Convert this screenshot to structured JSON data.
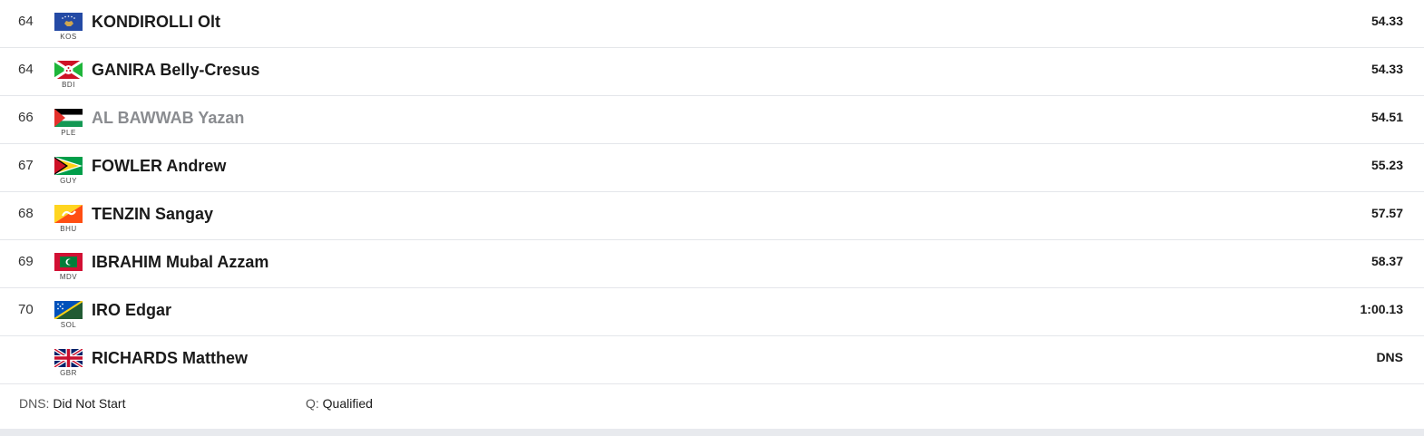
{
  "results": [
    {
      "rank": "64",
      "noc": "KOS",
      "name": "KONDIROLLI Olt",
      "result": "54.33",
      "dim": false
    },
    {
      "rank": "64",
      "noc": "BDI",
      "name": "GANIRA Belly-Cresus",
      "result": "54.33",
      "dim": false
    },
    {
      "rank": "66",
      "noc": "PLE",
      "name": "AL BAWWAB Yazan",
      "result": "54.51",
      "dim": true
    },
    {
      "rank": "67",
      "noc": "GUY",
      "name": "FOWLER Andrew",
      "result": "55.23",
      "dim": false
    },
    {
      "rank": "68",
      "noc": "BHU",
      "name": "TENZIN Sangay",
      "result": "57.57",
      "dim": false
    },
    {
      "rank": "69",
      "noc": "MDV",
      "name": "IBRAHIM Mubal Azzam",
      "result": "58.37",
      "dim": false
    },
    {
      "rank": "70",
      "noc": "SOL",
      "name": "IRO Edgar",
      "result": "1:00.13",
      "dim": false
    },
    {
      "rank": "",
      "noc": "GBR",
      "name": "RICHARDS Matthew",
      "result": "DNS",
      "dim": false
    }
  ],
  "legend": [
    {
      "abbr": "DNS:",
      "desc": "Did Not Start"
    },
    {
      "abbr": "Q:",
      "desc": "Qualified"
    }
  ],
  "colors": {
    "divider": "#e4e6ea",
    "dimmed_name": "#8a8c90",
    "footer_strip": "#e8eaee"
  }
}
